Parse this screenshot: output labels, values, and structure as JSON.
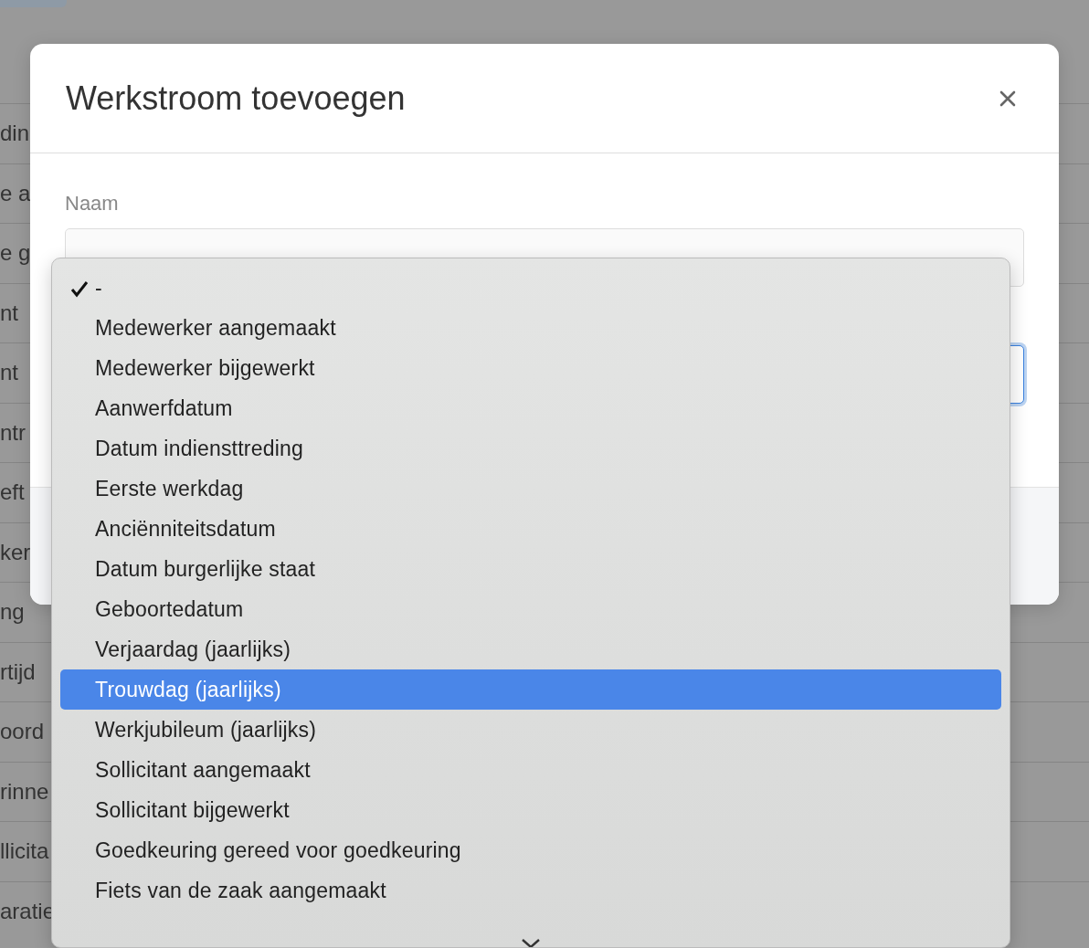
{
  "background_rows": [
    "din",
    "e a",
    "e g",
    "nt",
    "nt",
    "ntr",
    "eft",
    "ker",
    "ng",
    "rtijd",
    "oord",
    "rinne",
    "llicita",
    "aratie"
  ],
  "dialog": {
    "title": "Werkstroom toevoegen",
    "fields": [
      {
        "label": "Naam",
        "focused": false
      },
      {
        "focused": true
      }
    ]
  },
  "menu": {
    "items": [
      {
        "label": "-",
        "checked": true,
        "selected": false
      },
      {
        "label": "Medewerker aangemaakt",
        "checked": false,
        "selected": false
      },
      {
        "label": "Medewerker bijgewerkt",
        "checked": false,
        "selected": false
      },
      {
        "label": "Aanwerfdatum",
        "checked": false,
        "selected": false
      },
      {
        "label": "Datum indiensttreding",
        "checked": false,
        "selected": false
      },
      {
        "label": "Eerste werkdag",
        "checked": false,
        "selected": false
      },
      {
        "label": "Anciënniteitsdatum",
        "checked": false,
        "selected": false
      },
      {
        "label": "Datum burgerlijke staat",
        "checked": false,
        "selected": false
      },
      {
        "label": "Geboortedatum",
        "checked": false,
        "selected": false
      },
      {
        "label": "Verjaardag (jaarlijks)",
        "checked": false,
        "selected": false
      },
      {
        "label": "Trouwdag (jaarlijks)",
        "checked": false,
        "selected": true
      },
      {
        "label": "Werkjubileum (jaarlijks)",
        "checked": false,
        "selected": false
      },
      {
        "label": "Sollicitant aangemaakt",
        "checked": false,
        "selected": false
      },
      {
        "label": "Sollicitant bijgewerkt",
        "checked": false,
        "selected": false
      },
      {
        "label": "Goedkeuring gereed voor goedkeuring",
        "checked": false,
        "selected": false
      },
      {
        "label": "Fiets van de zaak aangemaakt",
        "checked": false,
        "selected": false
      }
    ]
  }
}
